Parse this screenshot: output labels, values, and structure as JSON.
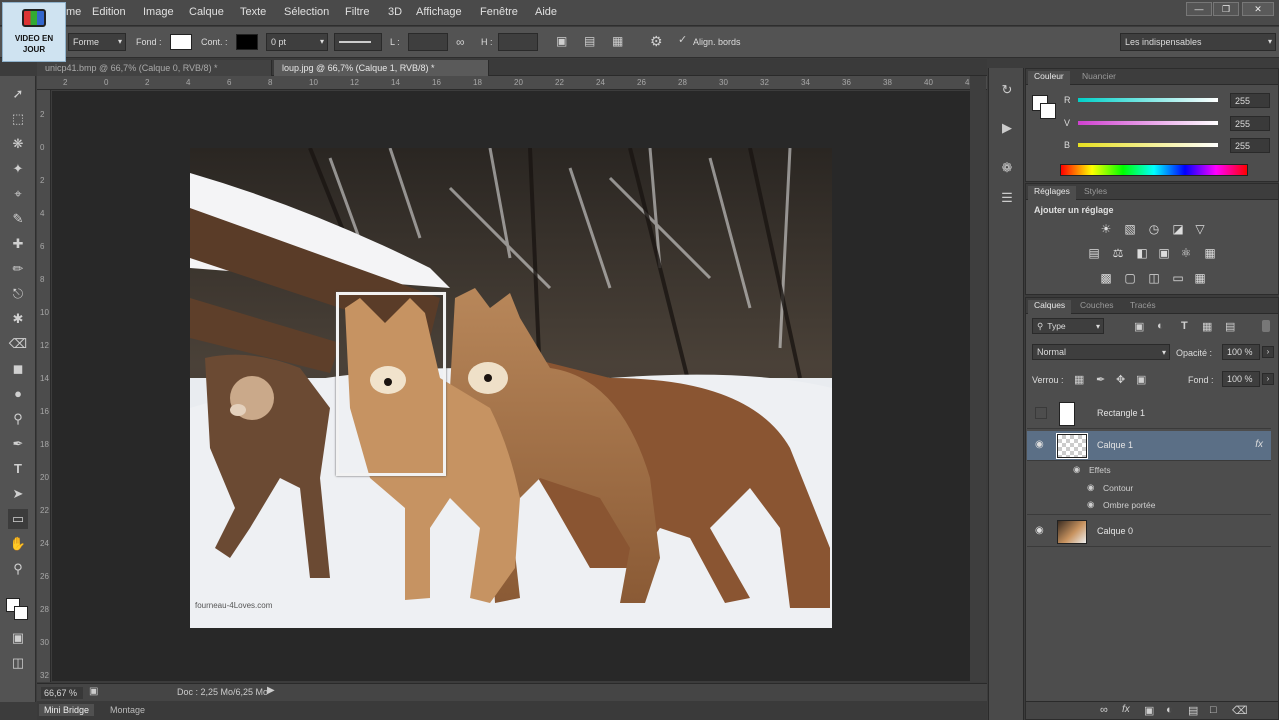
{
  "logo": {
    "line1": "VIDEO EN",
    "line2": "JOUR"
  },
  "menu": [
    "me",
    "Edition",
    "Image",
    "Calque",
    "Texte",
    "Sélection",
    "Filtre",
    "3D",
    "Affichage",
    "Fenêtre",
    "Aide"
  ],
  "options": {
    "shape_mode": "Forme",
    "fill_label": "Fond :",
    "stroke_label": "Cont. :",
    "stroke_width": "0 pt",
    "l_label": "L :",
    "h_label": "H :",
    "align_edges": "Align. bords",
    "workspace": "Les indispensables",
    "fill_color": "#ffffff",
    "stroke_color": "#000000"
  },
  "doc_tabs": [
    {
      "label": "unicp41.bmp @ 66,7% (Calque 0, RVB/8) *",
      "active": false
    },
    {
      "label": "loup.jpg @ 66,7% (Calque 1, RVB/8) *",
      "active": true
    }
  ],
  "ruler_top": [
    "2",
    "0",
    "2",
    "4",
    "6",
    "8",
    "10",
    "12",
    "14",
    "16",
    "18",
    "20",
    "22",
    "24",
    "26",
    "28",
    "30",
    "32",
    "34",
    "36",
    "38",
    "40",
    "42"
  ],
  "ruler_left": [
    "2",
    "0",
    "2",
    "4",
    "6",
    "8",
    "10",
    "12",
    "14",
    "16",
    "18",
    "20",
    "22",
    "24",
    "26",
    "28",
    "30",
    "32"
  ],
  "photo": {
    "watermark": "fourneau-4Loves.com"
  },
  "status": {
    "zoom": "66,67 %",
    "doc": "Doc : 2,25 Mo/6,25 Mo"
  },
  "bottom_tabs": [
    "Mini Bridge",
    "Montage"
  ],
  "color_panel": {
    "tabs": [
      "Couleur",
      "Nuancier"
    ],
    "channels": [
      {
        "label": "R",
        "value": "255",
        "gradient": "#00d0c8"
      },
      {
        "label": "V",
        "value": "255",
        "gradient": "#d040d0"
      },
      {
        "label": "B",
        "value": "255",
        "gradient": "#e8e020"
      }
    ]
  },
  "adjustments": {
    "tabs": [
      "Réglages",
      "Styles"
    ],
    "title": "Ajouter un réglage"
  },
  "layers": {
    "tabs": [
      "Calques",
      "Couches",
      "Tracés"
    ],
    "filter": "Type",
    "blend_mode": "Normal",
    "opacity_label": "Opacité :",
    "opacity": "100 %",
    "lock_label": "Verrou :",
    "fill_label": "Fond :",
    "fill": "100 %",
    "rows": [
      {
        "name": "Rectangle 1"
      },
      {
        "name": "Calque 1",
        "fx": "fx"
      },
      {
        "name": "Calque 0"
      }
    ],
    "effects_label": "Effets",
    "effects": [
      "Contour",
      "Ombre portée"
    ]
  }
}
